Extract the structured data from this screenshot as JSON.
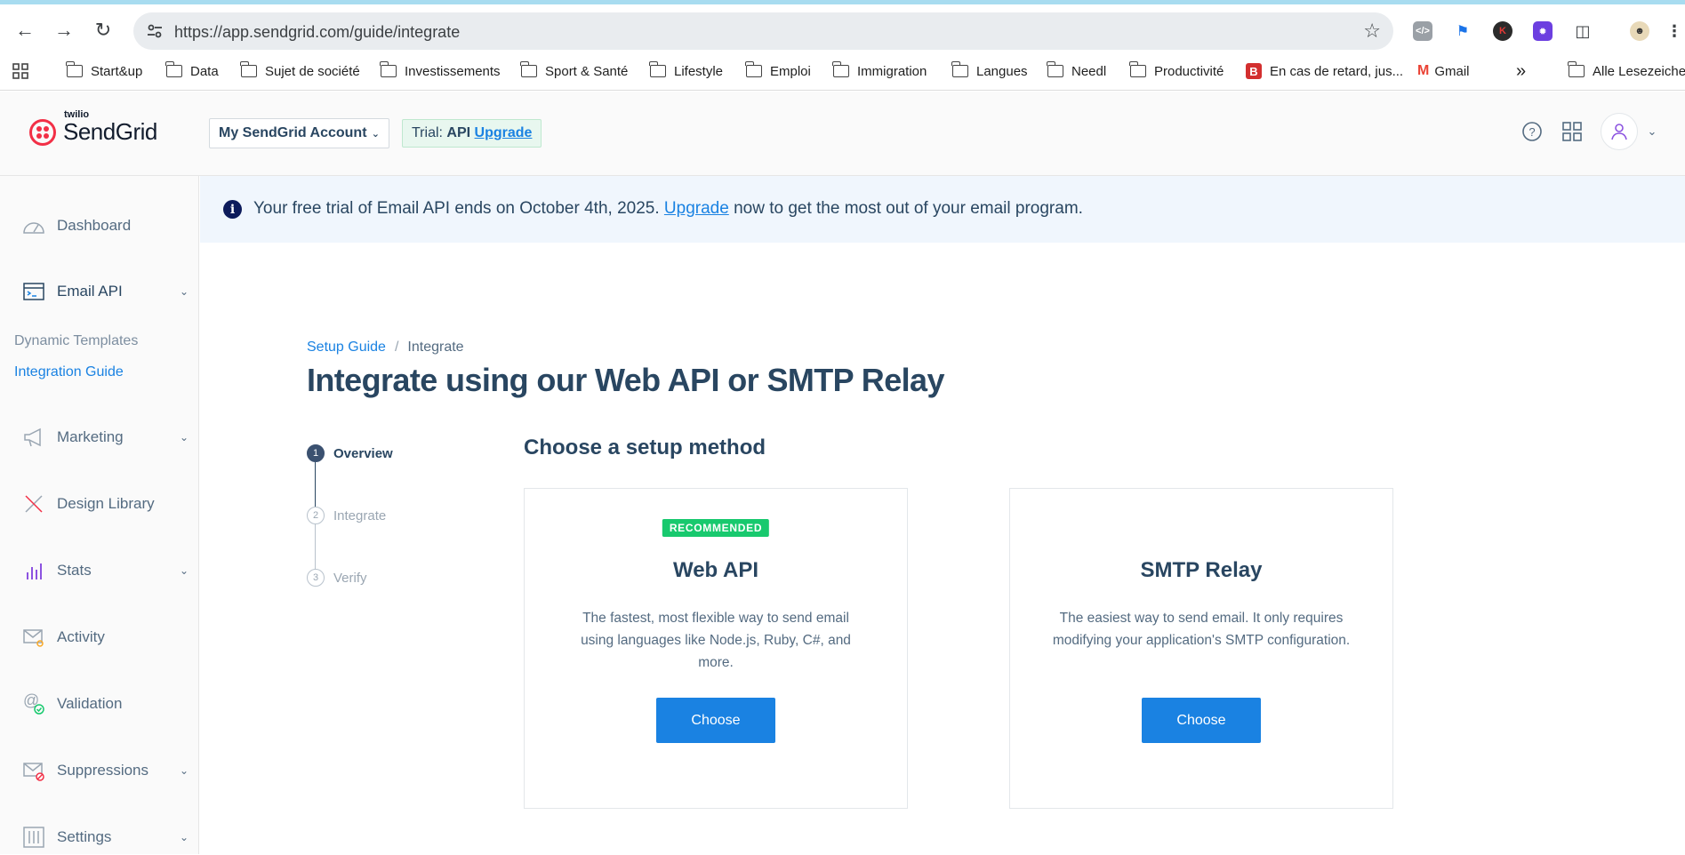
{
  "browser": {
    "url": "https://app.sendgrid.com/guide/integrate",
    "bookmarks": [
      "Start&up",
      "Data",
      "Sujet de société",
      "Investissements",
      "Sport & Santé",
      "Lifestyle",
      "Emploi",
      "Immigration",
      "Langues",
      "Needl",
      "Productivité",
      "En cas de retard, jus...",
      "Gmail",
      "Alle Lesezeichen"
    ],
    "overflow": "»"
  },
  "header": {
    "logo_small": "twilio",
    "logo_name": "SendGrid",
    "account_label": "My SendGrid Account",
    "trial_prefix": "Trial:",
    "trial_plan": "API",
    "trial_upgrade": "Upgrade"
  },
  "sidebar": {
    "items": [
      {
        "label": "Dashboard"
      },
      {
        "label": "Email API"
      },
      {
        "label": "Marketing"
      },
      {
        "label": "Design Library"
      },
      {
        "label": "Stats"
      },
      {
        "label": "Activity"
      },
      {
        "label": "Validation"
      },
      {
        "label": "Suppressions"
      },
      {
        "label": "Settings"
      }
    ],
    "subitems": [
      {
        "label": "Dynamic Templates"
      },
      {
        "label": "Integration Guide"
      }
    ]
  },
  "banner": {
    "text_before": "Your free trial of Email API ends on October 4th, 2025. ",
    "link": "Upgrade",
    "text_after": " now to get the most out of your email program."
  },
  "breadcrumb": {
    "parent": "Setup Guide",
    "separator": "/",
    "current": "Integrate"
  },
  "page_title": "Integrate using our Web API or SMTP Relay",
  "steps": [
    {
      "num": "1",
      "label": "Overview"
    },
    {
      "num": "2",
      "label": "Integrate"
    },
    {
      "num": "3",
      "label": "Verify"
    }
  ],
  "section_title": "Choose a setup method",
  "cards": [
    {
      "badge": "RECOMMENDED",
      "title": "Web API",
      "description": "The fastest, most flexible way to send email using languages like Node.js, Ruby, C#, and more.",
      "button": "Choose"
    },
    {
      "title": "SMTP Relay",
      "description": "The easiest way to send email. It only requires modifying your application's SMTP configuration.",
      "button": "Choose"
    }
  ],
  "colors": {
    "brand_red": "#f22f46",
    "primary_blue": "#1a82e2",
    "badge_green": "#18c96e",
    "text_dark": "#294661"
  }
}
